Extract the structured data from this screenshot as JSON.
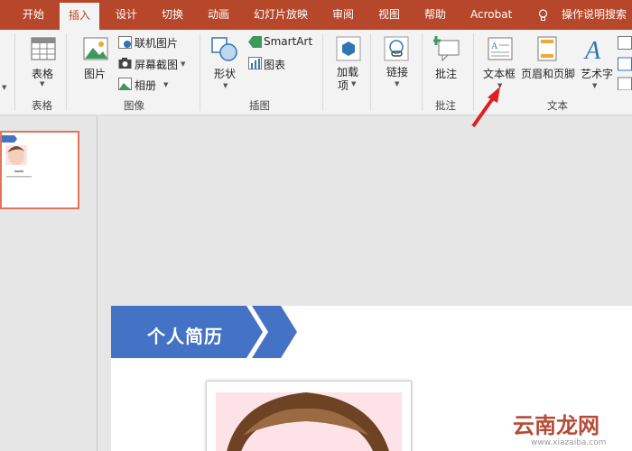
{
  "tabs": [
    {
      "label": "开始",
      "active": false
    },
    {
      "label": "插入",
      "active": true
    },
    {
      "label": "设计",
      "active": false
    },
    {
      "label": "切换",
      "active": false
    },
    {
      "label": "动画",
      "active": false
    },
    {
      "label": "幻灯片放映",
      "active": false
    },
    {
      "label": "审阅",
      "active": false
    },
    {
      "label": "视图",
      "active": false
    },
    {
      "label": "帮助",
      "active": false
    },
    {
      "label": "Acrobat",
      "active": false
    }
  ],
  "tell_me": "操作说明搜索",
  "ribbon": {
    "tables": {
      "button": "表格",
      "group": "表格"
    },
    "images": {
      "picture": "图片",
      "online_picture": "联机图片",
      "screenshot": "屏幕截图",
      "album": "相册",
      "group": "图像"
    },
    "illustrations": {
      "shapes": "形状",
      "smartart": "SmartArt",
      "chart": "图表",
      "group": "插图"
    },
    "addins": {
      "line1": "加载",
      "line2": "项"
    },
    "links": {
      "button": "链接"
    },
    "comments": {
      "button": "批注",
      "group": "批注"
    },
    "text": {
      "textbox": "文本框",
      "header_footer": "页眉和页脚",
      "wordart": "艺术字",
      "group": "文本"
    }
  },
  "slide": {
    "banner_title": "个人简历"
  },
  "watermark": {
    "main": "云南龙网",
    "sub": "www.xiazaiba.com"
  },
  "colors": {
    "accent": "#b7472a",
    "banner": "#4472c4",
    "thumb_border": "#e0755a",
    "arrow": "#e02020"
  }
}
